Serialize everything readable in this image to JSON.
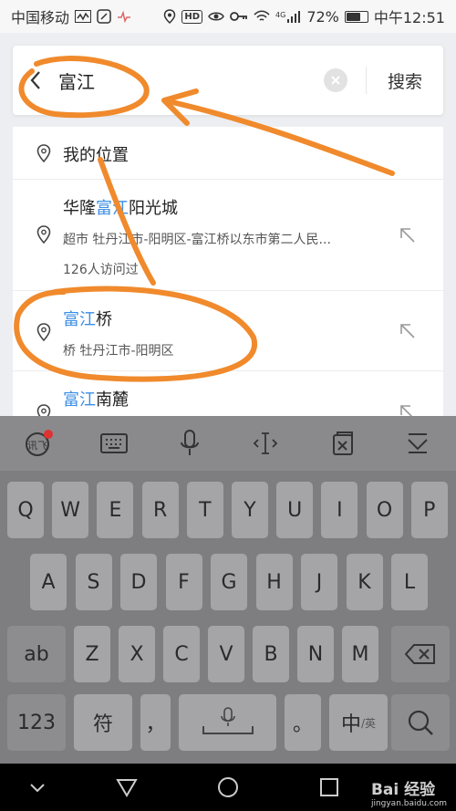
{
  "status_bar": {
    "carrier": "中国移动",
    "hd_badge": "HD",
    "network": "4G",
    "battery": "72%",
    "battery_level": 0.72,
    "time": "中午12:51"
  },
  "search": {
    "back_icon": "chevron-left-icon",
    "query": "富江",
    "clear_icon": "clear-circle-icon",
    "button_label": "搜索"
  },
  "suggestions": [
    {
      "title": "我的位置",
      "highlight": "",
      "rest": "",
      "subtitle": "",
      "extra": ""
    },
    {
      "title_pre": "华隆",
      "highlight": "富江",
      "title_post": "阳光城",
      "subtitle": "超市  牡丹江市-阳明区-富江桥以东市第二人民...",
      "extra": "126人访问过"
    },
    {
      "title_pre": "",
      "highlight": "富江",
      "title_post": "桥",
      "subtitle": "桥  牡丹江市-阳明区",
      "extra": ""
    },
    {
      "title_pre": "",
      "highlight": "富江",
      "title_post": "南麓",
      "subtitle": "",
      "extra": ""
    }
  ],
  "keyboard": {
    "toolbar_icons": [
      "iflytek-logo-icon",
      "keyboard-icon",
      "microphone-icon",
      "cursor-move-icon",
      "clipboard-icon",
      "collapse-keyboard-icon"
    ],
    "row1": [
      "Q",
      "W",
      "E",
      "R",
      "T",
      "Y",
      "U",
      "I",
      "O",
      "P"
    ],
    "row2": [
      "A",
      "S",
      "D",
      "F",
      "G",
      "H",
      "J",
      "K",
      "L"
    ],
    "row3": [
      "Z",
      "X",
      "C",
      "V",
      "B",
      "N",
      "M"
    ],
    "shift_label": "ab",
    "num_label": "123",
    "symbol_label": "符",
    "comma_label": "，",
    "period_label": "。",
    "lang_label": "中",
    "lang_sub_label": "/英",
    "space_icon": "microphone-icon",
    "backspace_icon": "backspace-icon",
    "search_icon": "search-icon"
  },
  "navbar": {
    "icons": [
      "nav-down-icon",
      "nav-back-icon",
      "nav-home-icon",
      "nav-recent-icon"
    ],
    "watermark": "Bai 经验",
    "watermark_url": "jingyan.baidu.com"
  },
  "colors": {
    "highlight": "#3a8ee6",
    "annotation": "#f08a2c"
  }
}
